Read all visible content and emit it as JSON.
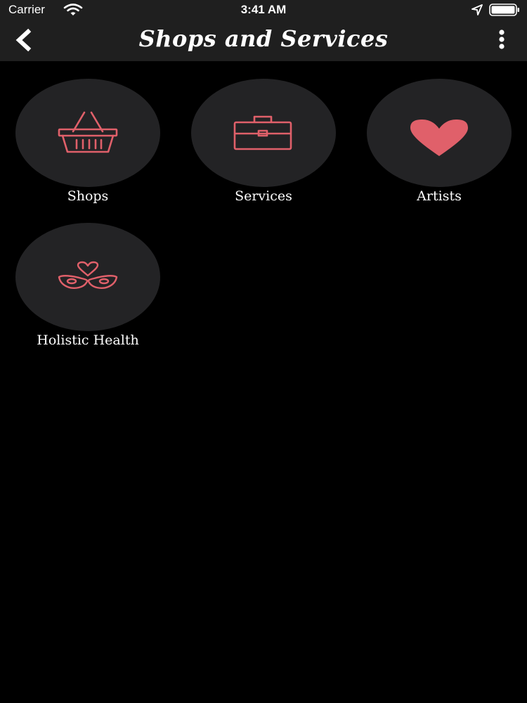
{
  "status_bar": {
    "carrier": "Carrier",
    "time": "3:41 AM"
  },
  "header": {
    "title": "Shops and Services",
    "back_icon": "chevron-left-icon",
    "menu_icon": "more-vertical-icon"
  },
  "categories": [
    {
      "label": "Shops",
      "icon": "shopping-basket-icon"
    },
    {
      "label": "Services",
      "icon": "briefcase-icon"
    },
    {
      "label": "Artists",
      "icon": "heart-icon"
    },
    {
      "label": "Holistic Health",
      "icon": "masks-heart-icon"
    }
  ],
  "colors": {
    "accent": "#e0606a",
    "background": "#000000",
    "bar": "#1f1f1f",
    "tile": "#232325",
    "text": "#ffffff"
  }
}
